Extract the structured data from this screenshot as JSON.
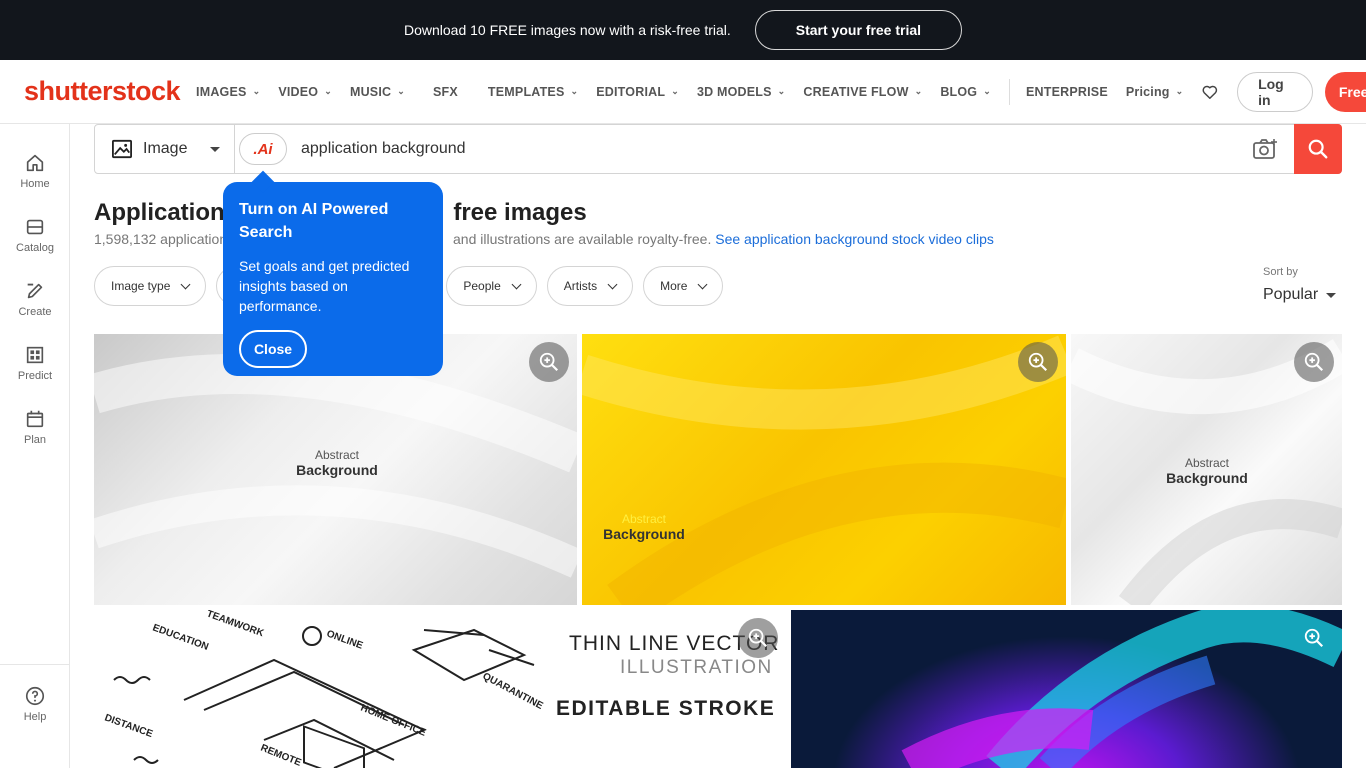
{
  "promo": {
    "text": "Download 10 FREE images now with a risk-free trial.",
    "button": "Start your free trial"
  },
  "nav": {
    "logo": "shutterstock",
    "items": [
      {
        "label": "IMAGES",
        "dropdown": true
      },
      {
        "label": "VIDEO",
        "dropdown": true
      },
      {
        "label": "MUSIC",
        "dropdown": true
      },
      {
        "label": "SFX",
        "dropdown": false
      },
      {
        "label": "TEMPLATES",
        "dropdown": true
      },
      {
        "label": "EDITORIAL",
        "dropdown": true
      },
      {
        "label": "3D MODELS",
        "dropdown": true
      },
      {
        "label": "CREATIVE FLOW",
        "dropdown": true
      },
      {
        "label": "BLOG",
        "dropdown": true
      }
    ],
    "enterprise": "ENTERPRISE",
    "pricing": "Pricing",
    "login": "Log in",
    "free_trial": "Free trial",
    "brand_color": "#f5483a"
  },
  "sidebar": {
    "items": [
      {
        "label": "Home",
        "icon": "home-icon"
      },
      {
        "label": "Catalog",
        "icon": "catalog-icon"
      },
      {
        "label": "Create",
        "icon": "create-icon"
      },
      {
        "label": "Predict",
        "icon": "predict-icon"
      },
      {
        "label": "Plan",
        "icon": "plan-icon"
      }
    ],
    "help": "Help"
  },
  "search": {
    "type": "Image",
    "ai_label": ".Ai",
    "query": "application background"
  },
  "results": {
    "heading_start": "Application ",
    "heading_end": "free images",
    "count_text": "1,598,132 application",
    "count_tail": " and illustrations are available royalty-free.",
    "video_link": "See application background stock video clips"
  },
  "filters": [
    "Image type",
    "",
    "People",
    "Artists",
    "More"
  ],
  "sort": {
    "label": "Sort by",
    "value": "Popular"
  },
  "tiles": {
    "t1": {
      "line1": "Abstract",
      "line2": "Background"
    },
    "t2": {
      "line1": "Abstract",
      "line2": "Background"
    },
    "t3": {
      "line1": "Abstract",
      "line2": "Background"
    },
    "t4": {
      "labels": [
        "EDUCATION",
        "TEAMWORK",
        "ONLINE",
        "HOME OFFICE",
        "QUARANTINE",
        "REMOTE",
        "DISTANCE"
      ],
      "heading1": "THIN LINE VECTOR",
      "heading2": "ILLUSTRATION",
      "heading3": "EDITABLE STROKE"
    }
  },
  "popover": {
    "title": "Turn on AI Powered Search",
    "body": "Set goals and get predicted insights based on performance.",
    "close": "Close"
  }
}
